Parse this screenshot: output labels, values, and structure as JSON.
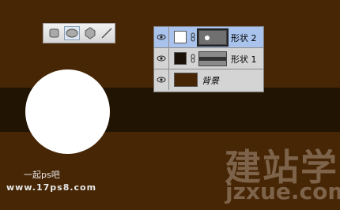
{
  "colors": {
    "canvas_bg": "#472605",
    "band": "#221403",
    "circle": "#ffffff",
    "selected_layer": "#a9c3ec"
  },
  "toolbar": {
    "tools": [
      {
        "icon": "rounded-rectangle-tool-icon"
      },
      {
        "icon": "ellipse-tool-icon",
        "selected": true
      },
      {
        "icon": "polygon-tool-icon"
      },
      {
        "icon": "line-tool-icon"
      }
    ]
  },
  "layers": {
    "items": [
      {
        "name": "形状 2",
        "swatch": "#ffffff",
        "selected": true
      },
      {
        "name": "形状 1",
        "swatch": "#1a1108",
        "selected": false
      },
      {
        "name": "背景",
        "selected": false
      }
    ]
  },
  "watermark": {
    "left_line1": "一起ps吧",
    "left_line2": "www.17ps8.com",
    "logo": "建站学",
    "url": "jzxue.com"
  }
}
